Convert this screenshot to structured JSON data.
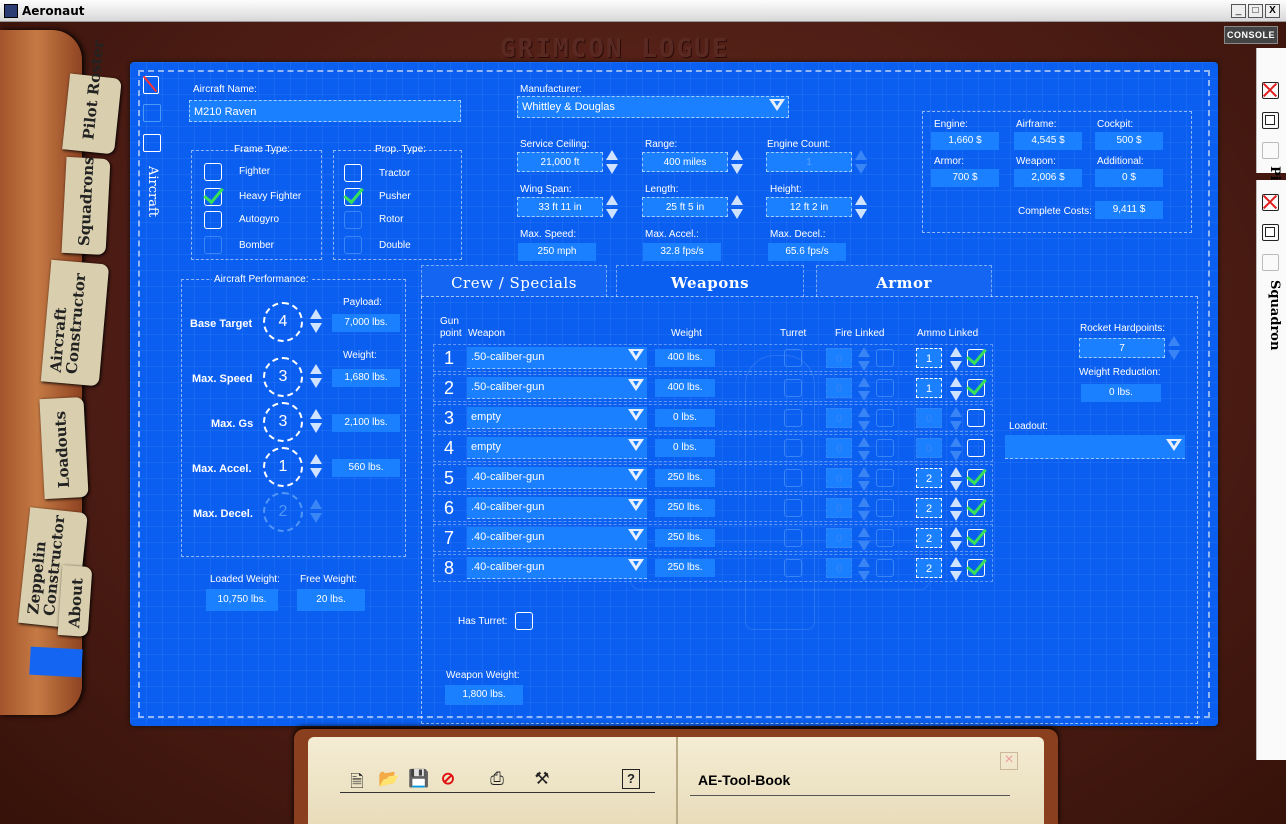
{
  "window": {
    "title": "Aeronaut",
    "controls": [
      "_",
      "□",
      "X"
    ]
  },
  "console_label": "CONSOLE",
  "watermark": "GRIMCON LOGUE",
  "left_tabs": {
    "pilot_roster": "Pilot Roster",
    "squadrons": "Squadrons",
    "aircraft_constructor": "Aircraft Constructor",
    "loadouts": "Loadouts",
    "zeppelin_constructor": "Zeppelin Constructor",
    "about": "About"
  },
  "side_label": "Aircraft",
  "right_panel": {
    "label_top": "Pi",
    "label_bottom": "Squadron"
  },
  "aircraft_name": {
    "label": "Aircraft Name:",
    "value": "M210 Raven"
  },
  "manufacturer": {
    "label": "Manufacturer:",
    "value": "Whittley & Douglas"
  },
  "frame_type": {
    "label": "Frame Type:",
    "options": [
      {
        "label": "Fighter",
        "checked": false,
        "enabled": true
      },
      {
        "label": "Heavy Fighter",
        "checked": true,
        "enabled": true
      },
      {
        "label": "Autogyro",
        "checked": false,
        "enabled": true
      },
      {
        "label": "Bomber",
        "checked": false,
        "enabled": false
      }
    ]
  },
  "prop_type": {
    "label": "Prop. Type:",
    "options": [
      {
        "label": "Tractor",
        "checked": false,
        "enabled": true
      },
      {
        "label": "Pusher",
        "checked": true,
        "enabled": true
      },
      {
        "label": "Rotor",
        "checked": false,
        "enabled": false
      },
      {
        "label": "Double",
        "checked": false,
        "enabled": false
      }
    ]
  },
  "specs": {
    "service_ceiling": {
      "label": "Service Ceiling:",
      "value": "21,000 ft"
    },
    "range": {
      "label": "Range:",
      "value": "400 miles"
    },
    "engine_count": {
      "label": "Engine Count:",
      "value": "1"
    },
    "wing_span": {
      "label": "Wing Span:",
      "value": "33 ft 11 in"
    },
    "length": {
      "label": "Length:",
      "value": "25 ft 5 in"
    },
    "height": {
      "label": "Height:",
      "value": "12 ft 2 in"
    },
    "max_speed": {
      "label": "Max. Speed:",
      "value": "250 mph"
    },
    "max_accel": {
      "label": "Max. Accel.:",
      "value": "32.8 fps/s"
    },
    "max_decel": {
      "label": "Max. Decel.:",
      "value": "65.6 fps/s"
    }
  },
  "costs": {
    "engine": {
      "label": "Engine:",
      "value": "1,660 $"
    },
    "airframe": {
      "label": "Airframe:",
      "value": "4,545 $"
    },
    "cockpit": {
      "label": "Cockpit:",
      "value": "500 $"
    },
    "armor": {
      "label": "Armor:",
      "value": "700 $"
    },
    "weapon": {
      "label": "Weapon:",
      "value": "2,006 $"
    },
    "additional": {
      "label": "Additional:",
      "value": "0 $"
    },
    "complete": {
      "label": "Complete Costs:",
      "value": "9,411 $"
    }
  },
  "performance": {
    "label": "Aircraft Performance:",
    "payload_label": "Payload:",
    "weight_label": "Weight:",
    "rows": [
      {
        "label": "Base Target",
        "value": "4",
        "weight": "7,000 lbs."
      },
      {
        "label": "Max. Speed",
        "value": "3",
        "weight": "1,680 lbs."
      },
      {
        "label": "Max. Gs",
        "value": "3",
        "weight": "2,100 lbs."
      },
      {
        "label": "Max. Accel.",
        "value": "1",
        "weight": "560 lbs."
      },
      {
        "label": "Max. Decel.",
        "value": "2",
        "weight": ""
      }
    ]
  },
  "loaded_weight": {
    "label": "Loaded Weight:",
    "value": "10,750 lbs."
  },
  "free_weight": {
    "label": "Free Weight:",
    "value": "20 lbs."
  },
  "tabs": [
    "Crew / Specials",
    "Weapons",
    "Armor"
  ],
  "active_tab": "Weapons",
  "weapons": {
    "headers": {
      "gunpoint": "Gun point",
      "weapon": "Weapon",
      "weight": "Weight",
      "turret": "Turret",
      "fire_linked": "Fire Linked",
      "ammo_linked": "Ammo Linked"
    },
    "rows": [
      {
        "num": "1",
        "weapon": ".50-caliber-gun",
        "weight": "400 lbs.",
        "fire": "0",
        "ammo": "1",
        "ammo_checked": true,
        "active": true
      },
      {
        "num": "2",
        "weapon": ".50-caliber-gun",
        "weight": "400 lbs.",
        "fire": "0",
        "ammo": "1",
        "ammo_checked": true,
        "active": true
      },
      {
        "num": "3",
        "weapon": "empty",
        "weight": "0 lbs.",
        "fire": "0",
        "ammo": "0",
        "ammo_checked": false,
        "active": false
      },
      {
        "num": "4",
        "weapon": "empty",
        "weight": "0 lbs.",
        "fire": "0",
        "ammo": "0",
        "ammo_checked": false,
        "active": false
      },
      {
        "num": "5",
        "weapon": ".40-caliber-gun",
        "weight": "250 lbs.",
        "fire": "0",
        "ammo": "2",
        "ammo_checked": true,
        "active": true
      },
      {
        "num": "6",
        "weapon": ".40-caliber-gun",
        "weight": "250 lbs.",
        "fire": "0",
        "ammo": "2",
        "ammo_checked": true,
        "active": true
      },
      {
        "num": "7",
        "weapon": ".40-caliber-gun",
        "weight": "250 lbs.",
        "fire": "0",
        "ammo": "2",
        "ammo_checked": true,
        "active": true
      },
      {
        "num": "8",
        "weapon": ".40-caliber-gun",
        "weight": "250 lbs.",
        "fire": "0",
        "ammo": "2",
        "ammo_checked": true,
        "active": true
      }
    ],
    "rocket_hardpoints": {
      "label": "Rocket Hardpoints:",
      "value": "7"
    },
    "weight_reduction": {
      "label": "Weight Reduction:",
      "value": "0 lbs."
    },
    "loadout": {
      "label": "Loadout:",
      "value": ""
    },
    "has_turret": {
      "label": "Has Turret:",
      "checked": false
    },
    "weapon_weight": {
      "label": "Weapon Weight:",
      "value": "1,800 lbs."
    }
  },
  "toolbook": {
    "title": "AE-Tool-Book",
    "icons": [
      "new-icon",
      "open-icon",
      "save-icon",
      "delete-icon",
      "print-icon",
      "tools-icon",
      "help-icon"
    ]
  }
}
